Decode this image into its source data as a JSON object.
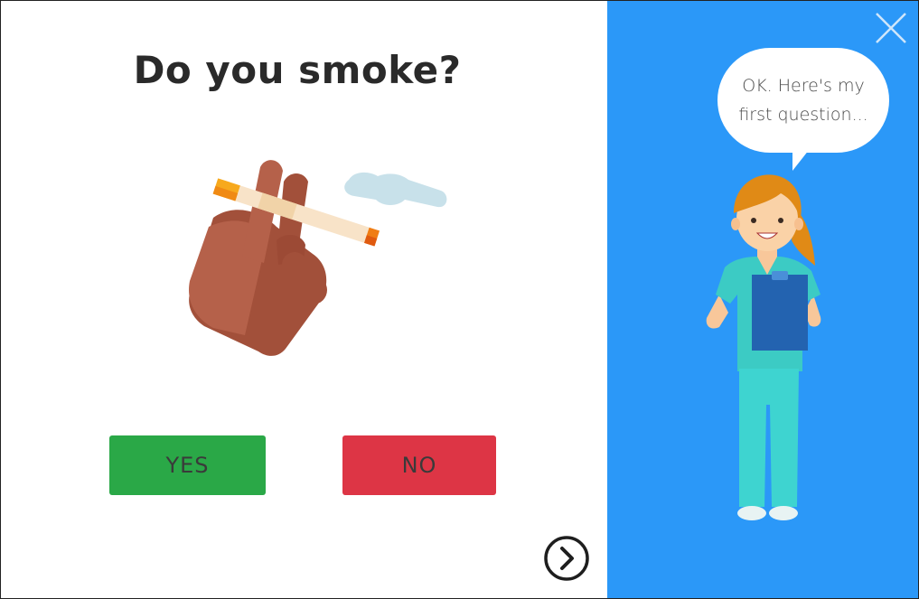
{
  "question": {
    "title": "Do you smoke?"
  },
  "answers": {
    "yes_label": "YES",
    "no_label": "NO"
  },
  "assistant": {
    "bubble_line1": "OK. Here's my",
    "bubble_line2": "first question..."
  },
  "icons": {
    "close": "close-icon",
    "next": "chevron-right-circle-icon",
    "illustration": "hand-holding-cigarette",
    "character": "nurse-with-clipboard"
  },
  "colors": {
    "panel_blue": "#2b98f8",
    "yes_green": "#2aa847",
    "no_red": "#dd3545"
  }
}
